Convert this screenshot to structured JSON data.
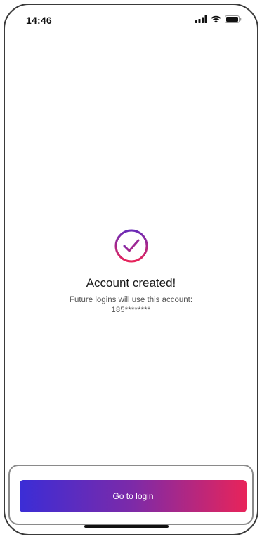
{
  "status_bar": {
    "time": "14:46",
    "icons": [
      "signal-icon",
      "wifi-icon",
      "battery-icon"
    ]
  },
  "success": {
    "icon": "check-circle-icon",
    "title": "Account created!",
    "subtitle": "Future logins will use this account:",
    "account": "185********"
  },
  "actions": {
    "login_label": "Go to login"
  },
  "colors": {
    "gradient_start": "#3b2dd6",
    "gradient_mid": "#7d2aa8",
    "gradient_end": "#e8245a"
  }
}
